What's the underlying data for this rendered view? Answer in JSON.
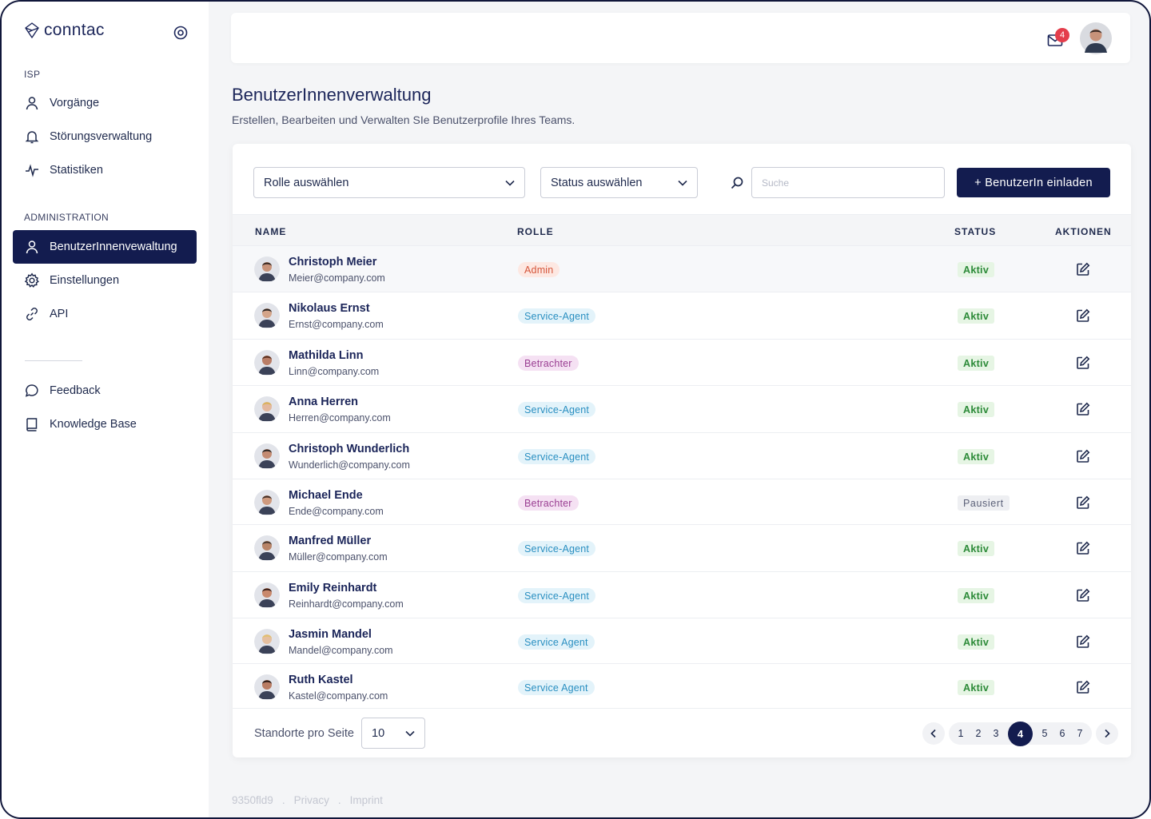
{
  "app": {
    "brand": "conntac"
  },
  "sidebar": {
    "sections": [
      {
        "label": "ISP"
      },
      {
        "label": "ADMINISTRATION"
      }
    ],
    "items": [
      {
        "label": "Vorgänge",
        "icon": "user-icon"
      },
      {
        "label": "Störungsverwaltung",
        "icon": "bell-icon"
      },
      {
        "label": "Statistiken",
        "icon": "activity-icon"
      },
      {
        "label": "BenutzerInnenvewaltung",
        "icon": "user-icon",
        "active": true
      },
      {
        "label": "Einstellungen",
        "icon": "gear-icon"
      },
      {
        "label": "API",
        "icon": "link-icon"
      },
      {
        "label": "Feedback",
        "icon": "chat-icon"
      },
      {
        "label": "Knowledge Base",
        "icon": "book-icon"
      }
    ]
  },
  "header": {
    "notifications": "4"
  },
  "page": {
    "title": "BenutzerInnenverwaltung",
    "subtitle": "Erstellen, Bearbeiten und Verwalten SIe Benutzerprofile Ihres Teams."
  },
  "filters": {
    "role_select": "Rolle auswählen",
    "status_select": "Status auswählen",
    "search_placeholder": "Suche",
    "invite_button": "+ BenutzerIn einladen"
  },
  "table": {
    "columns": [
      "NAME",
      "ROLLE",
      "STATUS",
      "AKTIONEN"
    ],
    "rows": [
      {
        "name": "Christoph Meier",
        "email": "Meier@company.com",
        "role": "Admin",
        "role_type": "admin",
        "status": "Aktiv",
        "status_type": "aktiv"
      },
      {
        "name": "Nikolaus Ernst",
        "email": "Ernst@company.com",
        "role": "Service-Agent",
        "role_type": "service",
        "status": "Aktiv",
        "status_type": "aktiv"
      },
      {
        "name": "Mathilda Linn",
        "email": "Linn@company.com",
        "role": "Betrachter",
        "role_type": "viewer",
        "status": "Aktiv",
        "status_type": "aktiv"
      },
      {
        "name": "Anna Herren",
        "email": "Herren@company.com",
        "role": "Service-Agent",
        "role_type": "service",
        "status": "Aktiv",
        "status_type": "aktiv"
      },
      {
        "name": "Christoph Wunderlich",
        "email": "Wunderlich@company.com",
        "role": "Service-Agent",
        "role_type": "service",
        "status": "Aktiv",
        "status_type": "aktiv"
      },
      {
        "name": "Michael Ende",
        "email": "Ende@company.com",
        "role": "Betrachter",
        "role_type": "viewer",
        "status": "Pausiert",
        "status_type": "paused"
      },
      {
        "name": "Manfred Müller",
        "email": "Müller@company.com",
        "role": "Service-Agent",
        "role_type": "service",
        "status": "Aktiv",
        "status_type": "aktiv"
      },
      {
        "name": "Emily Reinhardt",
        "email": "Reinhardt@company.com",
        "role": "Service-Agent",
        "role_type": "service",
        "status": "Aktiv",
        "status_type": "aktiv"
      },
      {
        "name": "Jasmin Mandel",
        "email": "Mandel@company.com",
        "role": "Service Agent",
        "role_type": "service",
        "status": "Aktiv",
        "status_type": "aktiv"
      },
      {
        "name": "Ruth Kastel",
        "email": "Kastel@company.com",
        "role": "Service Agent",
        "role_type": "service",
        "status": "Aktiv",
        "status_type": "aktiv"
      }
    ]
  },
  "pagination": {
    "per_page_label": "Standorte pro Seite",
    "per_page_value": "10",
    "pages_before": [
      "1",
      "2",
      "3"
    ],
    "current": "4",
    "pages_after": [
      "5",
      "6",
      "7"
    ]
  },
  "footer": {
    "version": "9350fld9",
    "sep": ".",
    "privacy": "Privacy",
    "imprint": "Imprint"
  },
  "colors": {
    "primary": "#131c4f",
    "badge": "#e43d4b",
    "aktiv": "#2c8a38",
    "admin": "#d5553a",
    "service": "#2a8fc1",
    "viewer": "#9a3e92"
  }
}
